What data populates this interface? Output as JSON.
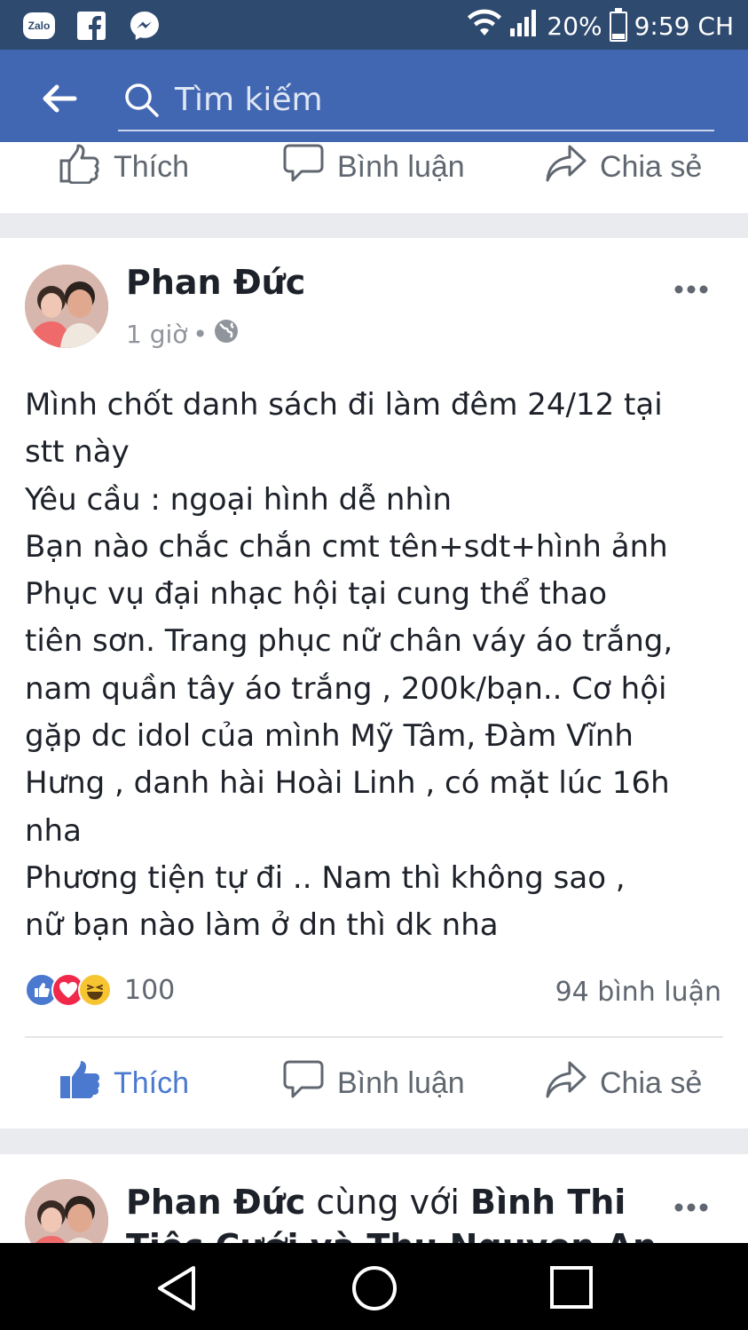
{
  "status_bar": {
    "apps": [
      "Zalo",
      "Facebook",
      "Messenger"
    ],
    "zalo_label": "Zalo",
    "battery": "20%",
    "time": "9:59 CH"
  },
  "search": {
    "placeholder": "Tìm kiếm"
  },
  "actions": {
    "like": "Thích",
    "comment": "Bình luận",
    "share": "Chia sẻ"
  },
  "post": {
    "author": "Phan Đức",
    "time": "1 giờ",
    "privacy_icon": "globe-icon",
    "lines": [
      "Mình chốt danh sách đi làm đêm 24/12 tại",
      "stt này",
      "Yêu cầu : ngoại hình dễ nhìn",
      "Bạn nào chắc chắn cmt tên+sdt+hình ảnh",
      "Phục vụ đại nhạc hội tại cung thể thao",
      "tiên sơn. Trang phục nữ chân váy áo trắng,",
      "nam quần tây áo trắng , 200k/bạn.. Cơ hội",
      "gặp dc idol của mình Mỹ Tâm, Đàm Vĩnh",
      "Hưng , danh hài Hoài Linh , có mặt lúc 16h",
      "nha",
      "Phương tiện tự đi .. Nam thì không sao ,",
      "nữ bạn nào làm ở dn thì dk nha"
    ],
    "reaction_count": "100",
    "comment_count": "94 bình luận"
  },
  "next_post": {
    "author": "Phan Đức",
    "with_text": "cùng với",
    "tagged": "Bình Thi",
    "cut_line": "Tiệc Cưới và Thu Nguyen An"
  },
  "colors": {
    "status_bar": "#2f4a6f",
    "top_bar": "#4267b2",
    "like_active": "#4a79cf",
    "text": "#1d2129",
    "muted": "#606770"
  }
}
